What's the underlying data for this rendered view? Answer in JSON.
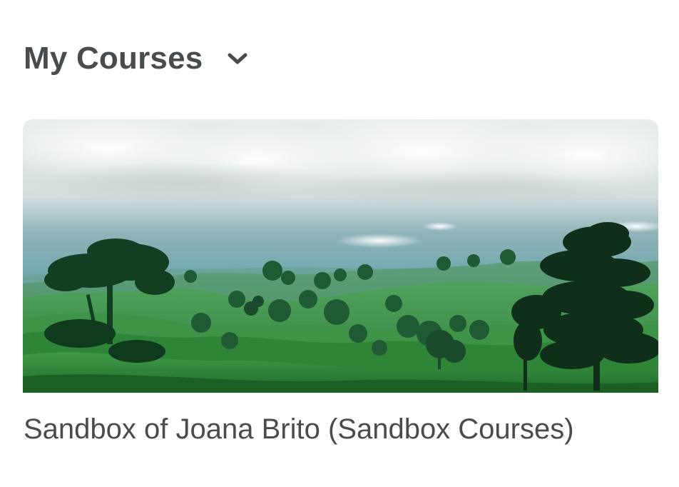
{
  "widget": {
    "title": "My Courses",
    "toggle_icon": "chevron-down-icon"
  },
  "courses": [
    {
      "name": "Sandbox of Joana Brito (Sandbox Courses)",
      "image": "green-hills-landscape"
    }
  ],
  "colors": {
    "text": "#494c4e"
  }
}
